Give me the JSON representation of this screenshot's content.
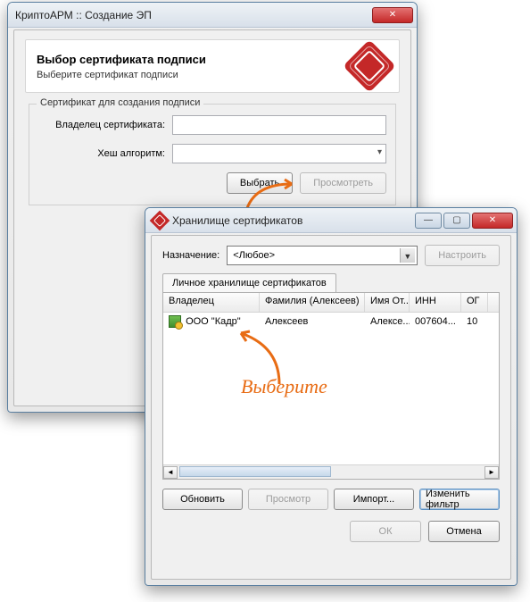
{
  "window1": {
    "title": "КриптоАРМ :: Создание ЭП",
    "header_title": "Выбор сертификата подписи",
    "header_subtitle": "Выберите сертификат подписи",
    "group_legend": "Сертификат для создания подписи",
    "owner_label": "Владелец сертификата:",
    "hash_label": "Хеш алгоритм:",
    "btn_select": "Выбрать",
    "btn_view": "Просмотреть"
  },
  "window2": {
    "title": "Хранилище сертификатов",
    "purpose_label": "Назначение:",
    "purpose_value": "<Любое>",
    "btn_configure": "Настроить",
    "tab_personal": "Личное хранилище сертификатов",
    "cols": {
      "owner": "Владелец",
      "surname": "Фамилия (Алексеев)",
      "name": "Имя От...",
      "inn": "ИНН",
      "og": "ОГ"
    },
    "row": {
      "owner": "ООО \"Кадр\"",
      "surname": "Алексеев",
      "name": "Алексе...",
      "inn": "007604...",
      "og": "10"
    },
    "btn_refresh": "Обновить",
    "btn_view": "Просмотр",
    "btn_import": "Импорт...",
    "btn_filter": "Изменить фильтр",
    "btn_ok": "ОК",
    "btn_cancel": "Отмена"
  },
  "annotation": "Выберите"
}
